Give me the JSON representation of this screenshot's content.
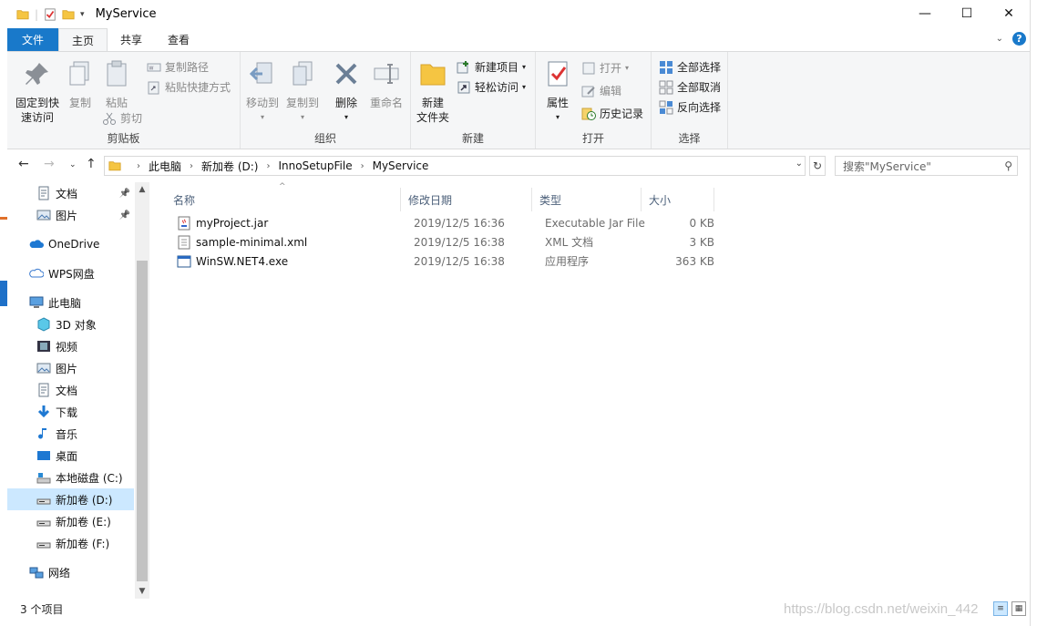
{
  "window": {
    "title": "MyService",
    "controls": {
      "minimize": "—",
      "maximize": "☐",
      "close": "✕"
    }
  },
  "ribbon_tabs": [
    "文件",
    "主页",
    "共享",
    "查看"
  ],
  "ribbon": {
    "clipboard": {
      "label": "剪贴板",
      "pin": "固定到快速访问",
      "pin_line1": "固定到快",
      "pin_line2": "速访问",
      "copy": "复制",
      "paste": "粘贴",
      "copy_path": "复制路径",
      "paste_shortcut": "粘贴快捷方式",
      "cut": "剪切"
    },
    "organize": {
      "label": "组织",
      "move_to": "移动到",
      "copy_to": "复制到",
      "delete": "删除",
      "rename": "重命名"
    },
    "new": {
      "label": "新建",
      "new_folder_line1": "新建",
      "new_folder_line2": "文件夹",
      "new_item": "新建项目",
      "easy_access": "轻松访问"
    },
    "open": {
      "label": "打开",
      "properties": "属性",
      "open": "打开",
      "edit": "编辑",
      "history": "历史记录"
    },
    "select": {
      "label": "选择",
      "select_all": "全部选择",
      "select_none": "全部取消",
      "invert": "反向选择"
    }
  },
  "address": {
    "crumbs": [
      "此电脑",
      "新加卷 (D:)",
      "InnoSetupFile",
      "MyService"
    ],
    "search_placeholder": "搜索\"MyService\""
  },
  "nav": {
    "items": [
      {
        "label": "文档",
        "icon": "documents-icon",
        "pinned": true
      },
      {
        "label": "图片",
        "icon": "pictures-icon",
        "pinned": true
      },
      {
        "label": "OneDrive",
        "icon": "onedrive-icon"
      },
      {
        "label": "WPS网盘",
        "icon": "wps-cloud-icon"
      },
      {
        "label": "此电脑",
        "icon": "this-pc-icon"
      },
      {
        "label": "3D 对象",
        "icon": "3d-objects-icon"
      },
      {
        "label": "视频",
        "icon": "videos-icon"
      },
      {
        "label": "图片",
        "icon": "pictures-icon"
      },
      {
        "label": "文档",
        "icon": "documents-icon"
      },
      {
        "label": "下载",
        "icon": "downloads-icon"
      },
      {
        "label": "音乐",
        "icon": "music-icon"
      },
      {
        "label": "桌面",
        "icon": "desktop-icon"
      },
      {
        "label": "本地磁盘 (C:)",
        "icon": "system-drive-icon"
      },
      {
        "label": "新加卷 (D:)",
        "icon": "drive-icon",
        "selected": true
      },
      {
        "label": "新加卷 (E:)",
        "icon": "drive-icon"
      },
      {
        "label": "新加卷 (F:)",
        "icon": "drive-icon"
      },
      {
        "label": "网络",
        "icon": "network-icon"
      }
    ]
  },
  "columns": [
    "名称",
    "修改日期",
    "类型",
    "大小"
  ],
  "files": [
    {
      "name": "myProject.jar",
      "modified": "2019/12/5 16:36",
      "type": "Executable Jar File",
      "size": "0 KB",
      "icon": "jar-file-icon"
    },
    {
      "name": "sample-minimal.xml",
      "modified": "2019/12/5 16:38",
      "type": "XML 文档",
      "size": "3 KB",
      "icon": "xml-file-icon"
    },
    {
      "name": "WinSW.NET4.exe",
      "modified": "2019/12/5 16:38",
      "type": "应用程序",
      "size": "363 KB",
      "icon": "exe-file-icon"
    }
  ],
  "status": {
    "item_count": "3 个项目"
  },
  "watermark": "https://blog.csdn.net/weixin_442",
  "colors": {
    "accent": "#1979ca",
    "selected": "#cce8ff",
    "ribbon_bg": "#f5f6f7"
  }
}
